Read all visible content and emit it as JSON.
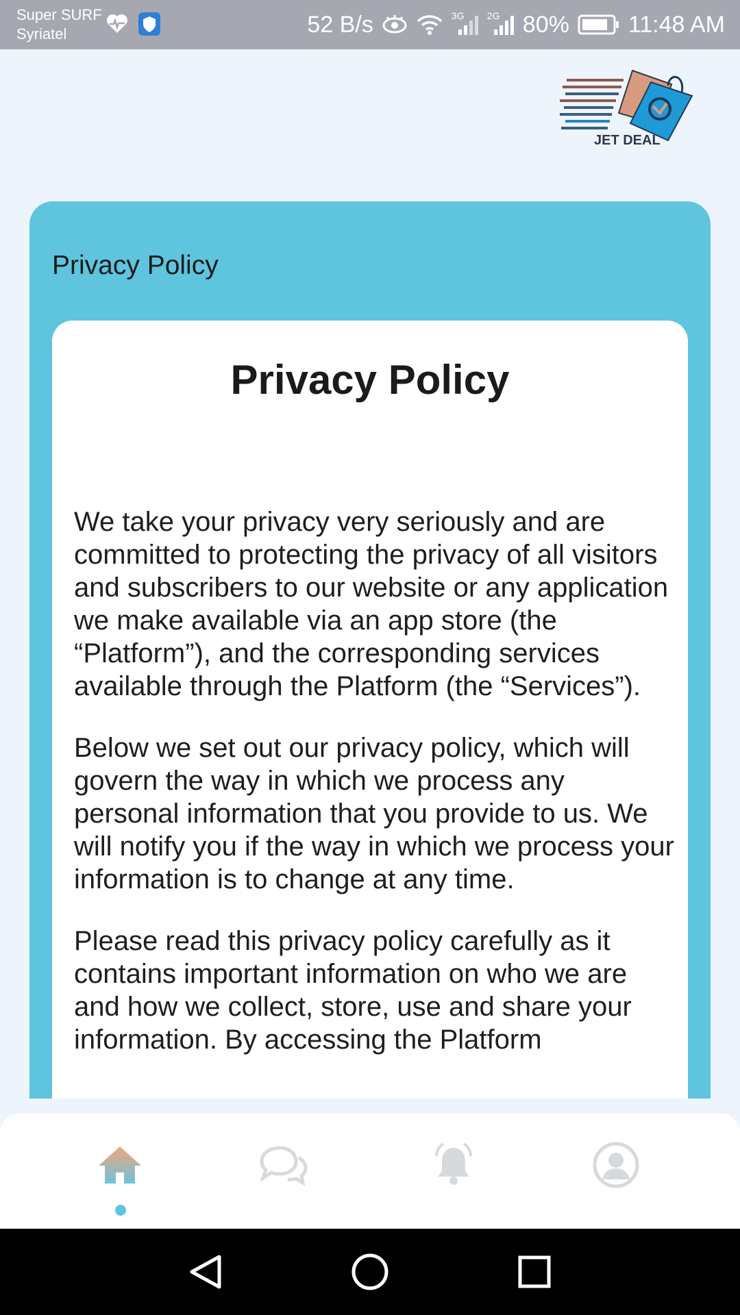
{
  "status_bar": {
    "carrier_line1": "Super SURF",
    "carrier_line2": "Syriatel",
    "net_speed": "52 B/s",
    "net1": "3G",
    "net2": "2G",
    "battery": "80%",
    "time": "11:48 AM",
    "icons": [
      "heart-rate-icon",
      "shield-icon",
      "eye-icon",
      "wifi-icon",
      "signal-icon",
      "battery-icon"
    ]
  },
  "header": {
    "logo_text": "JET DEAL"
  },
  "card": {
    "title": "Privacy Policy"
  },
  "document": {
    "heading": "Privacy Policy",
    "paragraphs": [
      "We take your privacy very seriously and are committed to protecting the privacy of all visitors and subscribers to our website or any application we make available via an app store (the “Platform”), and the corresponding services available through the Platform (the “Services”).",
      "Below we set out our privacy policy, which will govern the way in which we process any personal information that you provide to us. We will notify you if the way in which we process your information is to change at any time.",
      "Please read this privacy policy carefully as it contains important information on who we are and how we collect, store, use and share your information. By accessing the Platform"
    ]
  },
  "bottom_nav": {
    "items": [
      "home-icon",
      "chat-icon",
      "notifications-icon",
      "profile-icon"
    ],
    "active": "home-icon"
  },
  "colors": {
    "accent": "#5fc4de",
    "background": "#eef4fb",
    "status_bar": "#a5a8b0",
    "icon_inactive": "#d7dadd"
  }
}
